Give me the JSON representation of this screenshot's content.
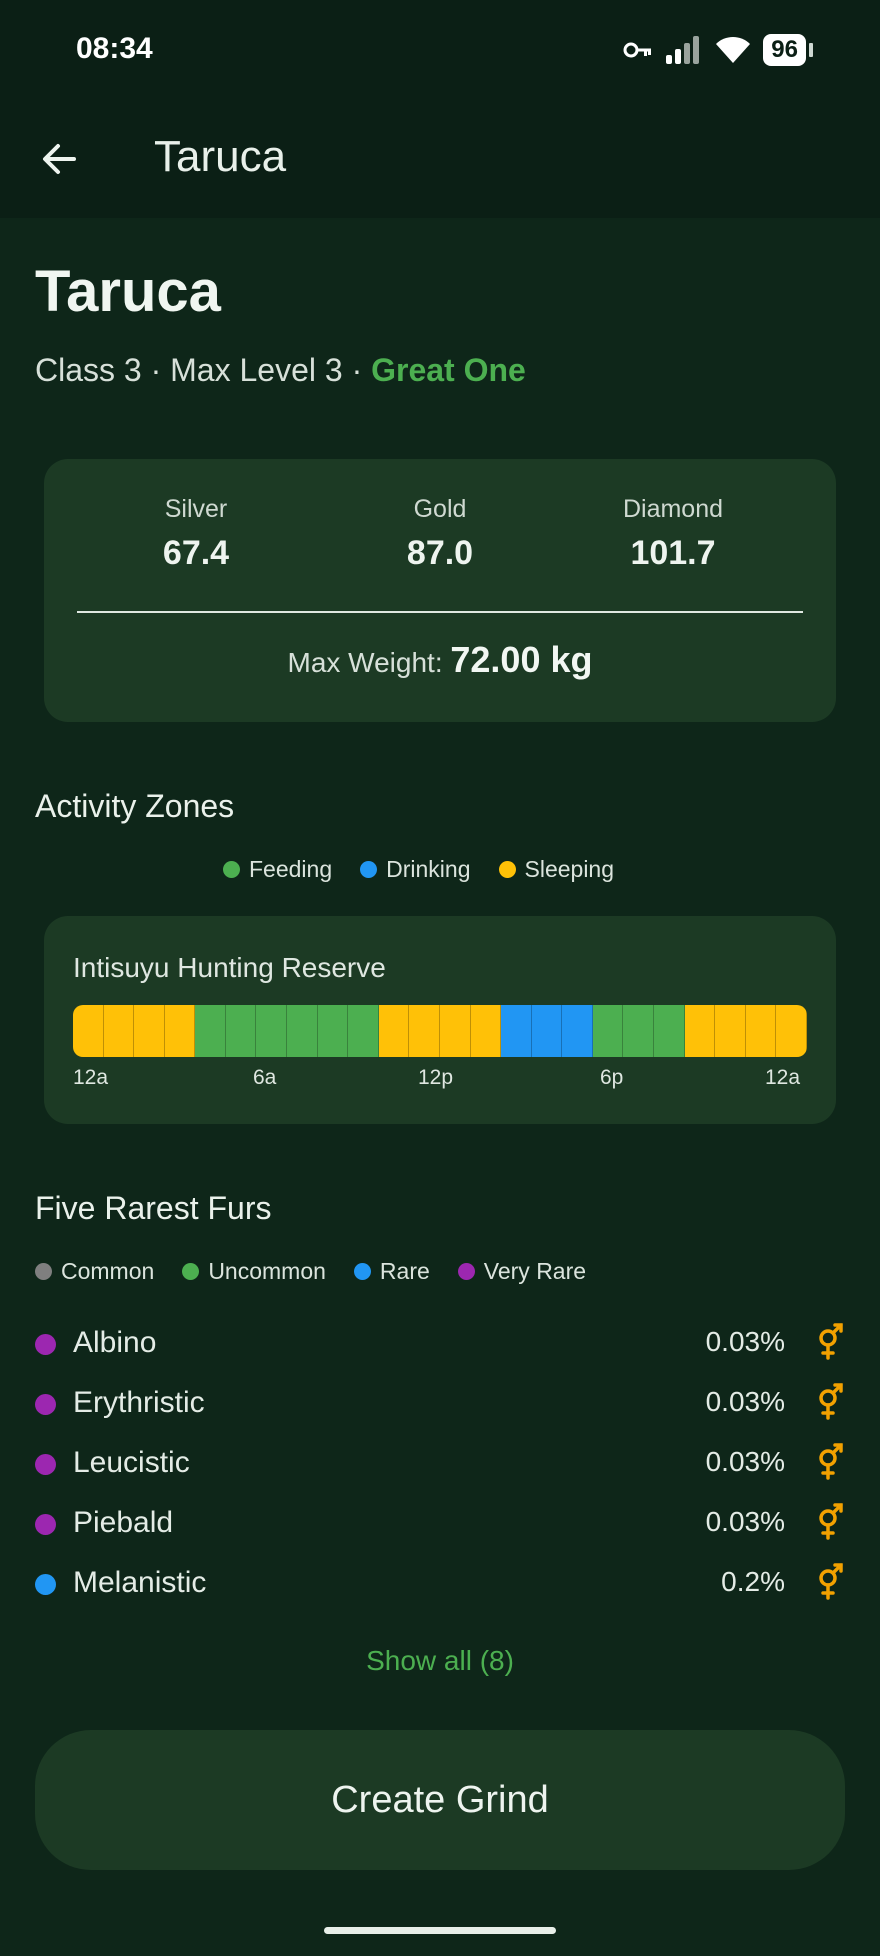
{
  "status_bar": {
    "time": "08:34",
    "battery": "96"
  },
  "app_bar": {
    "title": "Taruca"
  },
  "species": {
    "name": "Taruca",
    "meta_prefix": "Class 3 · Max Level 3 · ",
    "great_one": "Great One"
  },
  "trophy": {
    "silver_label": "Silver",
    "silver_value": "67.4",
    "gold_label": "Gold",
    "gold_value": "87.0",
    "diamond_label": "Diamond",
    "diamond_value": "101.7",
    "max_weight_label": "Max Weight:",
    "max_weight_value": "72.00 kg"
  },
  "activity": {
    "title": "Activity Zones",
    "legend": [
      {
        "label": "Feeding",
        "color": "#4caf50"
      },
      {
        "label": "Drinking",
        "color": "#2196f3"
      },
      {
        "label": "Sleeping",
        "color": "#ffc107"
      }
    ],
    "reserve": "Intisuyu Hunting Reserve",
    "ticks": [
      "12a",
      "6a",
      "12p",
      "6p",
      "12a"
    ],
    "hours": [
      "sleeping",
      "sleeping",
      "sleeping",
      "sleeping",
      "feeding",
      "feeding",
      "feeding",
      "feeding",
      "feeding",
      "feeding",
      "sleeping",
      "sleeping",
      "sleeping",
      "sleeping",
      "drinking",
      "drinking",
      "drinking",
      "feeding",
      "feeding",
      "feeding",
      "sleeping",
      "sleeping",
      "sleeping",
      "sleeping"
    ]
  },
  "furs": {
    "title": "Five Rarest Furs",
    "legend": [
      {
        "label": "Common",
        "color": "#7f7f7f"
      },
      {
        "label": "Uncommon",
        "color": "#4caf50"
      },
      {
        "label": "Rare",
        "color": "#2196f3"
      },
      {
        "label": "Very Rare",
        "color": "#9c27b0"
      }
    ],
    "items": [
      {
        "name": "Albino",
        "pct": "0.03%",
        "color": "#9c27b0"
      },
      {
        "name": "Erythristic",
        "pct": "0.03%",
        "color": "#9c27b0"
      },
      {
        "name": "Leucistic",
        "pct": "0.03%",
        "color": "#9c27b0"
      },
      {
        "name": "Piebald",
        "pct": "0.03%",
        "color": "#9c27b0"
      },
      {
        "name": "Melanistic",
        "pct": "0.2%",
        "color": "#2196f3"
      }
    ],
    "show_all": "Show all (8)"
  },
  "create_button": "Create Grind",
  "colors": {
    "accent": "#4caf50",
    "sex_icon": "#f2a100",
    "card": "#1c3a24",
    "background": "#0e2619"
  }
}
